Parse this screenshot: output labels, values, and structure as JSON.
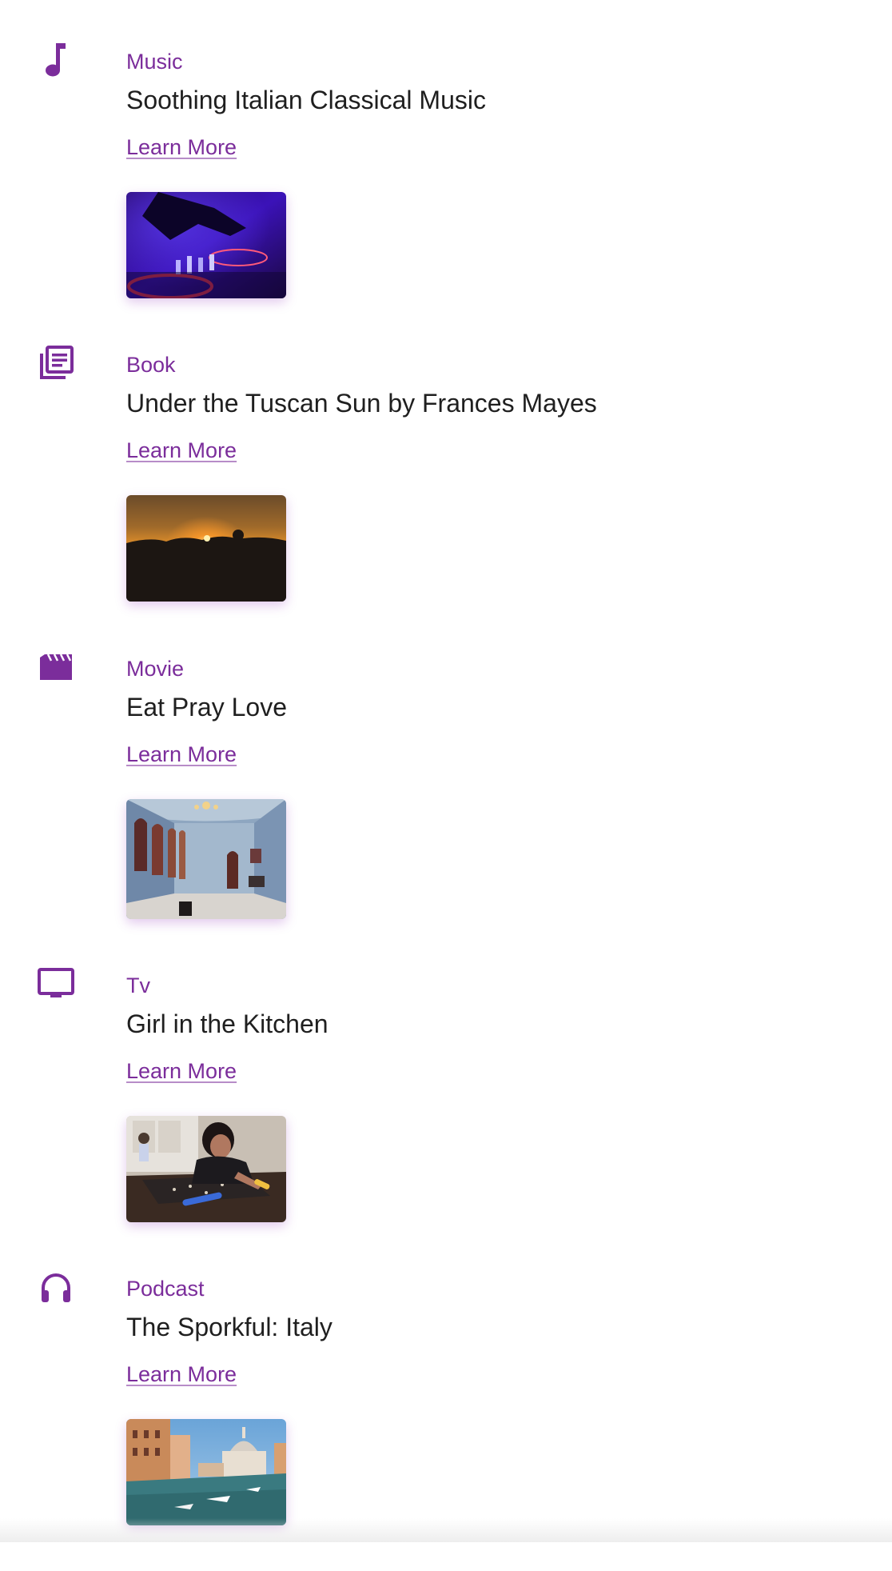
{
  "colors": {
    "accent": "#7b2d9b",
    "title_text": "#1f1f1f"
  },
  "items": [
    {
      "category": "Music",
      "icon": "music-note-icon",
      "title": "Soothing Italian Classical Music",
      "link_label": "Learn More",
      "image_subject": "dj-turntable"
    },
    {
      "category": "Book",
      "icon": "library-books-icon",
      "title": "Under the Tuscan Sun by Frances Mayes",
      "link_label": "Learn More",
      "image_subject": "sunset-field"
    },
    {
      "category": "Movie",
      "icon": "clapperboard-icon",
      "title": "Eat Pray Love",
      "link_label": "Learn More",
      "image_subject": "blue-palace-room"
    },
    {
      "category": "Tv",
      "icon": "television-icon",
      "title": "Girl in the Kitchen",
      "link_label": "Learn More",
      "image_subject": "girl-at-table"
    },
    {
      "category": "Podcast",
      "icon": "headphones-icon",
      "title": "The Sporkful: Italy",
      "link_label": "Learn More",
      "image_subject": "venice-canal"
    }
  ]
}
